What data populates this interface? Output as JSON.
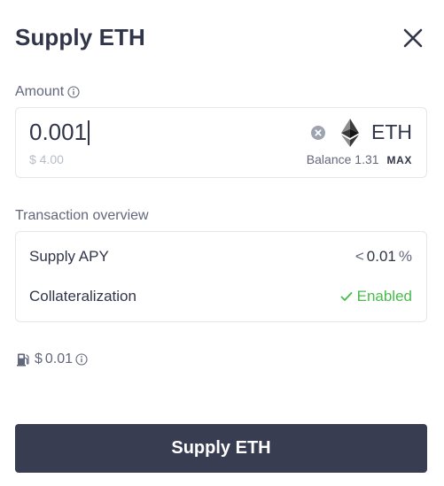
{
  "modal": {
    "title": "Supply ETH"
  },
  "amount": {
    "label": "Amount",
    "value": "0.001",
    "usd_value": "$ 4.00",
    "token_symbol": "ETH",
    "balance_label": "Balance",
    "balance_value": "1.31",
    "max_label": "MAX"
  },
  "overview": {
    "label": "Transaction overview",
    "rows": [
      {
        "label": "Supply APY",
        "prefix": "<",
        "value": "0.01",
        "suffix": "%"
      },
      {
        "label": "Collateralization",
        "value": "Enabled"
      }
    ]
  },
  "gas": {
    "currency": "$",
    "value": "0.01"
  },
  "submit": {
    "label": "Supply ETH"
  },
  "colors": {
    "primary_button": "#383d51",
    "text": "#303549",
    "muted_text": "#62677b",
    "success": "#46bc4b",
    "border": "#e4e6ec"
  },
  "icons": [
    "close-icon",
    "info-icon",
    "clear-icon",
    "eth-logo-icon",
    "check-icon",
    "gas-pump-icon"
  ]
}
